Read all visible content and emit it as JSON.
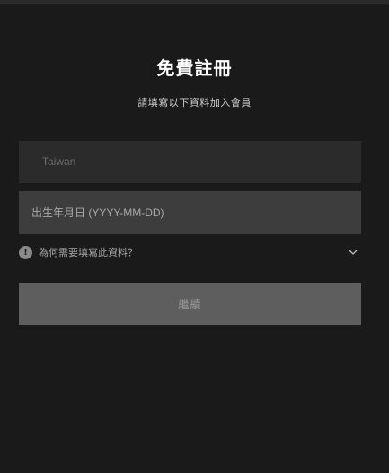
{
  "form": {
    "title": "免費註冊",
    "subtitle": "請填寫以下資料加入會員",
    "country_value": "Taiwan",
    "birthdate_placeholder": "出生年月日 (YYYY-MM-DD)",
    "birthdate_value": "",
    "why_label": "為何需要填寫此資料？",
    "info_icon": "info-icon",
    "chevron_icon": "chevron-down-icon",
    "continue_label": "繼續"
  },
  "colors": {
    "background": "#1a1a1a",
    "field_dark": "#2b2b2b",
    "field_active": "#3d3d3d",
    "button_disabled": "#5e5e5e",
    "text_primary": "#ffffff",
    "text_muted": "#a8a8a8"
  }
}
